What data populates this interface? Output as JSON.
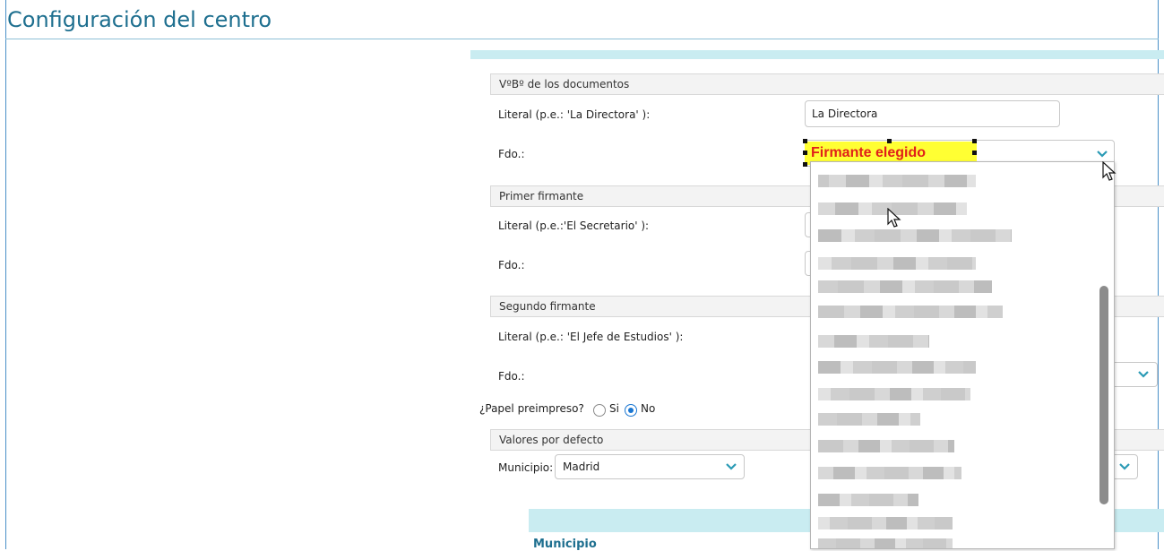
{
  "page": {
    "title": "Configuración del centro"
  },
  "vobo": {
    "header": "VºBº de los documentos",
    "literal_label": "Literal (p.e.: 'La Directora' ):",
    "literal_value": "La Directora",
    "fdo_label": "Fdo.:",
    "fdo_selected": "Firmante elegido"
  },
  "primer": {
    "header": "Primer firmante",
    "literal_label": "Literal (p.e.:'El Secretario' ):",
    "fdo_label": "Fdo.:"
  },
  "segundo": {
    "header": "Segundo firmante",
    "literal_label": "Literal (p.e.: 'El Jefe de Estudios' ):",
    "fdo_label": "Fdo.:"
  },
  "papel": {
    "question": "¿Papel preimpreso?",
    "options": [
      "Si",
      "No"
    ],
    "selected": "No"
  },
  "defaults": {
    "header": "Valores por defecto",
    "municipio_label": "Municipio:",
    "municipio_value": "Madrid"
  },
  "table": {
    "col_header": "Municipio"
  },
  "dropdown": {
    "items": [
      "[redacted name 1]",
      "[redacted name 2]",
      "[redacted name 3]",
      "[redacted name 4]",
      "[redacted name 5]",
      "[redacted name 6]",
      "[redacted name 7]",
      "[redacted name 8]",
      "[redacted name 9]",
      "[redacted name 10]",
      "[redacted name 11]",
      "[redacted name 12]",
      "[redacted name 13]",
      "[redacted name 14]",
      "[redacted name 15]",
      "[redacted name 16]"
    ]
  },
  "colors": {
    "title": "#1e6f8f",
    "accent_band": "#c9ecf1",
    "highlight": "#ffff33",
    "highlight_text": "#e0201a",
    "radio_selected": "#1976d2"
  },
  "icons": {
    "select_chevron": "chevron-down-icon",
    "cursor": "mouse-pointer-icon"
  }
}
